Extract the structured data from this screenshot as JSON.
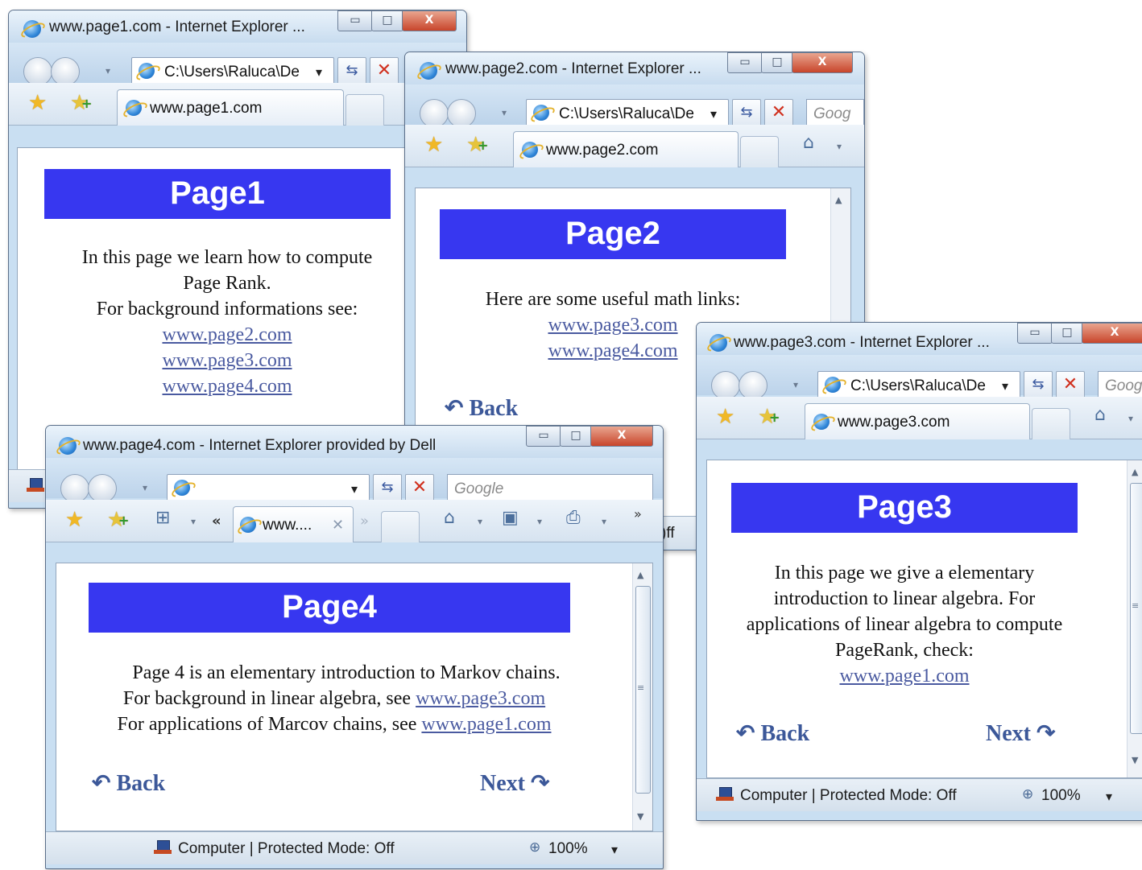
{
  "window1": {
    "title": "www.page1.com - Internet Explorer ...",
    "address": "C:\\Users\\Raluca\\De",
    "tab_label": "www.page1.com",
    "banner": "Page1",
    "line1": "In this page we learn how to compute",
    "line2": "Page Rank.",
    "line3": "For background informations see:",
    "links": [
      "www.page2.com",
      "www.page3.com",
      "www.page4.com"
    ]
  },
  "window2": {
    "title": "www.page2.com - Internet Explorer ...",
    "address": "C:\\Users\\Raluca\\De",
    "search_placeholder": "Goog",
    "tab_label": "www.page2.com",
    "banner": "Page2",
    "line1": "Here are some useful math links:",
    "links": [
      "www.page3.com",
      "www.page4.com"
    ],
    "back_label": "Back",
    "status_fragment": ")ff"
  },
  "window3": {
    "title": "www.page3.com - Internet Explorer ...",
    "address": "C:\\Users\\Raluca\\De",
    "search_placeholder": "Goog",
    "tab_label": "www.page3.com",
    "banner": "Page3",
    "line1": "In this page we give a elementary",
    "line2": "introduction to linear algebra. For",
    "line3": "applications of linear algebra to compute",
    "line4": "PageRank, check:",
    "link": "www.page1.com",
    "back_label": "Back",
    "next_label": "Next",
    "status": "Computer | Protected Mode: Off",
    "zoom": "100%"
  },
  "window4": {
    "title": "www.page4.com - Internet Explorer provided by Dell",
    "search_placeholder": "Google",
    "tab_label": "www....",
    "banner": "Page4",
    "line1": "Page 4 is an elementary introduction to Markov chains.",
    "line2_prefix": "For background in linear algebra, see ",
    "line2_link": "www.page3.com",
    "line3_prefix": "For applications of Marcov chains, see ",
    "line3_link": "www.page1.com",
    "back_label": "Back",
    "next_label": "Next",
    "status": "Computer | Protected Mode: Off",
    "zoom": "100%"
  },
  "glyphs": {
    "minimize": "▭",
    "maximize": "□",
    "close": "X",
    "dropdown": "▾",
    "refresh": "⇆",
    "stop": "✕",
    "home": "⌂",
    "rss": "▣",
    "print": "⎙",
    "chevron_left": "«",
    "chevron_right": "»",
    "quicktabs": "⊞",
    "back_curve": "↶",
    "next_curve": "↷",
    "scroll_up": "▲",
    "scroll_down": "▼",
    "grip": "≡",
    "zoom": "⊕",
    "tab_close": "✕"
  },
  "colors": {
    "banner_blue": "#3737f0",
    "link": "#4a5aa0",
    "nav_link": "#3c5899"
  }
}
